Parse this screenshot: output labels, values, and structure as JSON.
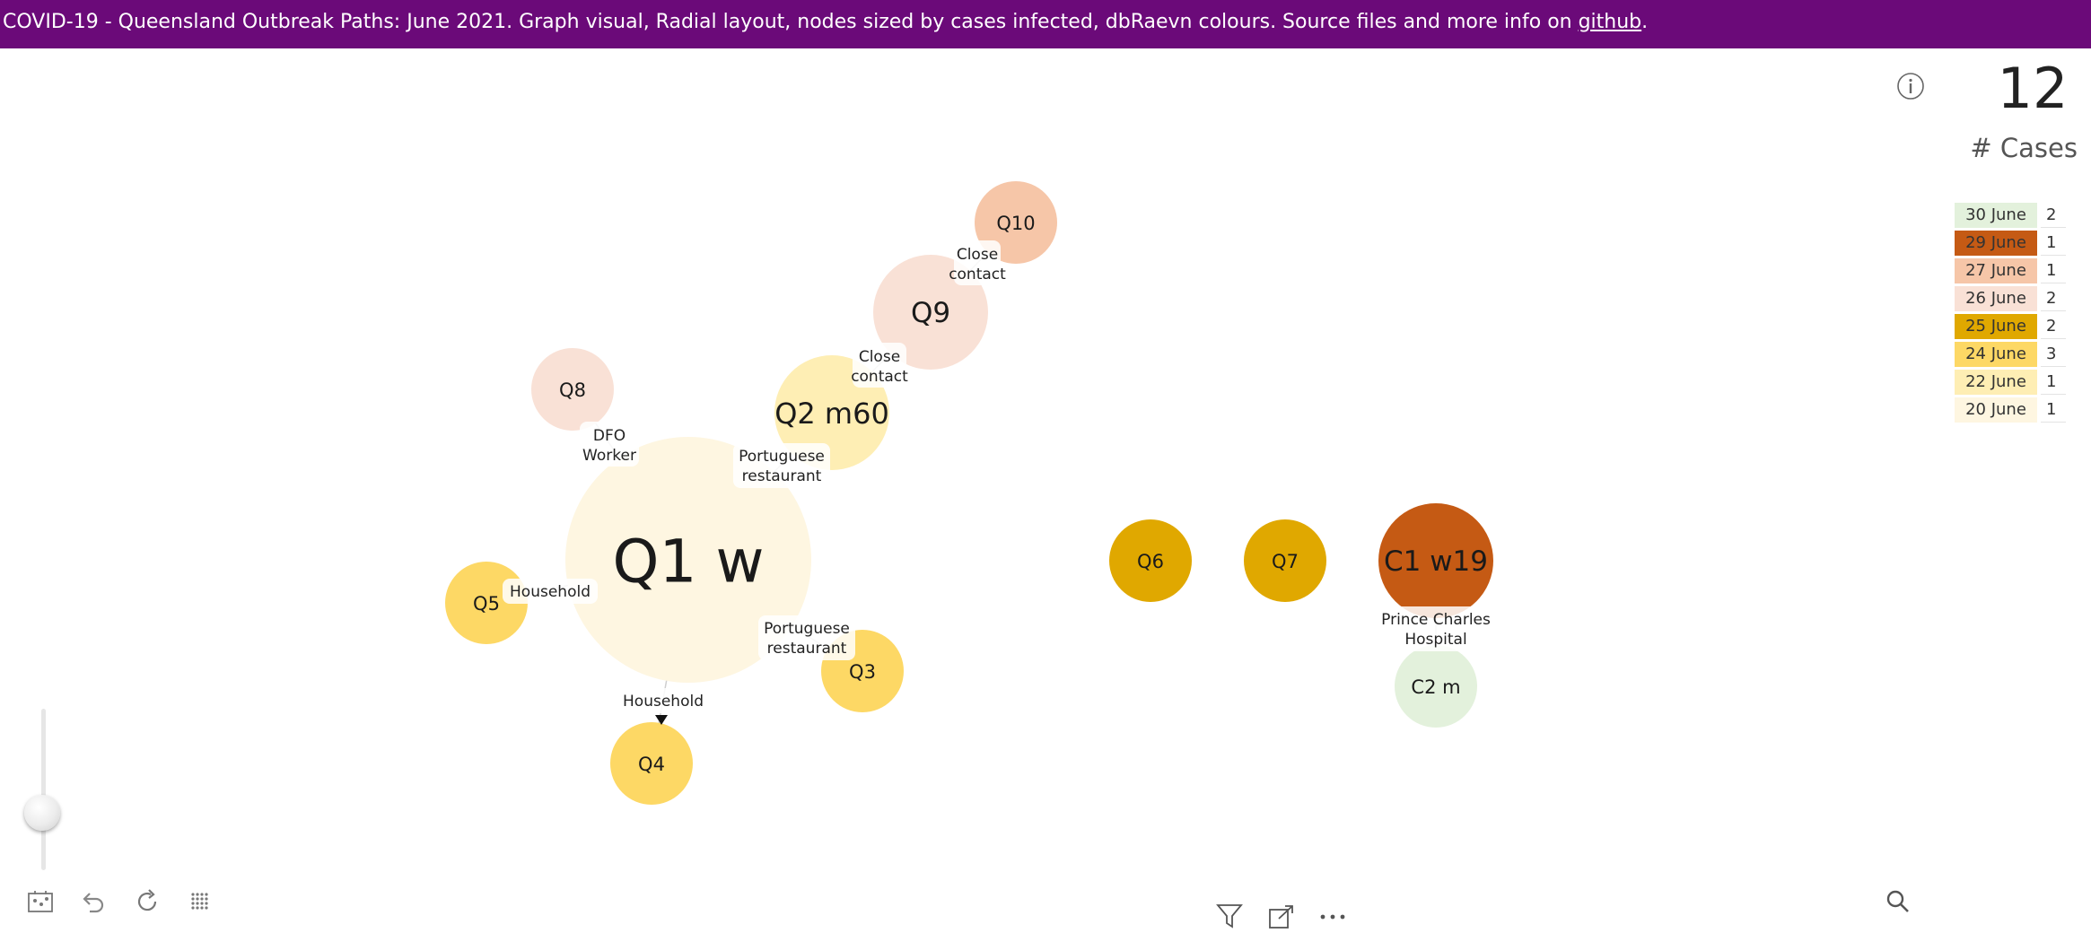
{
  "banner": {
    "text": "COVID-19  - Queensland Outbreak Paths: June 2021.  Graph visual, Radial layout, nodes sized by cases infected, dbRaevn colours. Source files and more info on ",
    "link": "github",
    "suffix": "."
  },
  "kpi": {
    "value": "12",
    "label": "# Cases"
  },
  "legend": [
    {
      "date": "30 June",
      "count": "2",
      "color": "#e3f1dc"
    },
    {
      "date": "29 June",
      "count": "1",
      "color": "#c55a14"
    },
    {
      "date": "27 June",
      "count": "1",
      "color": "#f6c6a8"
    },
    {
      "date": "26 June",
      "count": "2",
      "color": "#f9e1d6"
    },
    {
      "date": "25 June",
      "count": "2",
      "color": "#e0a800"
    },
    {
      "date": "24 June",
      "count": "3",
      "color": "#fdd865"
    },
    {
      "date": "22 June",
      "count": "1",
      "color": "#feeeb4"
    },
    {
      "date": "20 June",
      "count": "1",
      "color": "#fef6e1"
    }
  ],
  "graph": {
    "nodes": {
      "q1": {
        "label": "Q1 w",
        "color": "#fef6e1"
      },
      "q2": {
        "label": "Q2 m60",
        "color": "#feeeb4"
      },
      "q3": {
        "label": "Q3",
        "color": "#fdd865"
      },
      "q4": {
        "label": "Q4",
        "color": "#fdd865"
      },
      "q5": {
        "label": "Q5",
        "color": "#fdd865"
      },
      "q6": {
        "label": "Q6",
        "color": "#e0a800"
      },
      "q7": {
        "label": "Q7",
        "color": "#e0a800"
      },
      "q8": {
        "label": "Q8",
        "color": "#f9e1d6"
      },
      "q9": {
        "label": "Q9",
        "color": "#f9e1d6"
      },
      "q10": {
        "label": "Q10",
        "color": "#f6c6a8"
      },
      "c1": {
        "label": "C1 w19",
        "color": "#c55a14"
      },
      "c2": {
        "label": "C2 m",
        "color": "#e3f1dc"
      }
    },
    "edges": {
      "q10_q9": [
        "Close",
        "contact"
      ],
      "q9_q2": [
        "Close",
        "contact"
      ],
      "q8_q1": [
        "DFO",
        "Worker"
      ],
      "q2_q1": [
        "Portuguese",
        "restaurant"
      ],
      "q5_q1": [
        "Household"
      ],
      "q3_q1": [
        "Portuguese",
        "restaurant"
      ],
      "q4_q1": [
        "Household"
      ],
      "c1_c2": [
        "Prince Charles",
        "Hospital"
      ]
    }
  },
  "toolbar": {
    "icons": [
      "graph-settings-icon",
      "undo-icon",
      "refresh-icon",
      "grid-icon",
      "filter-icon",
      "focus-mode-icon",
      "more-options-icon",
      "search-icon"
    ]
  }
}
